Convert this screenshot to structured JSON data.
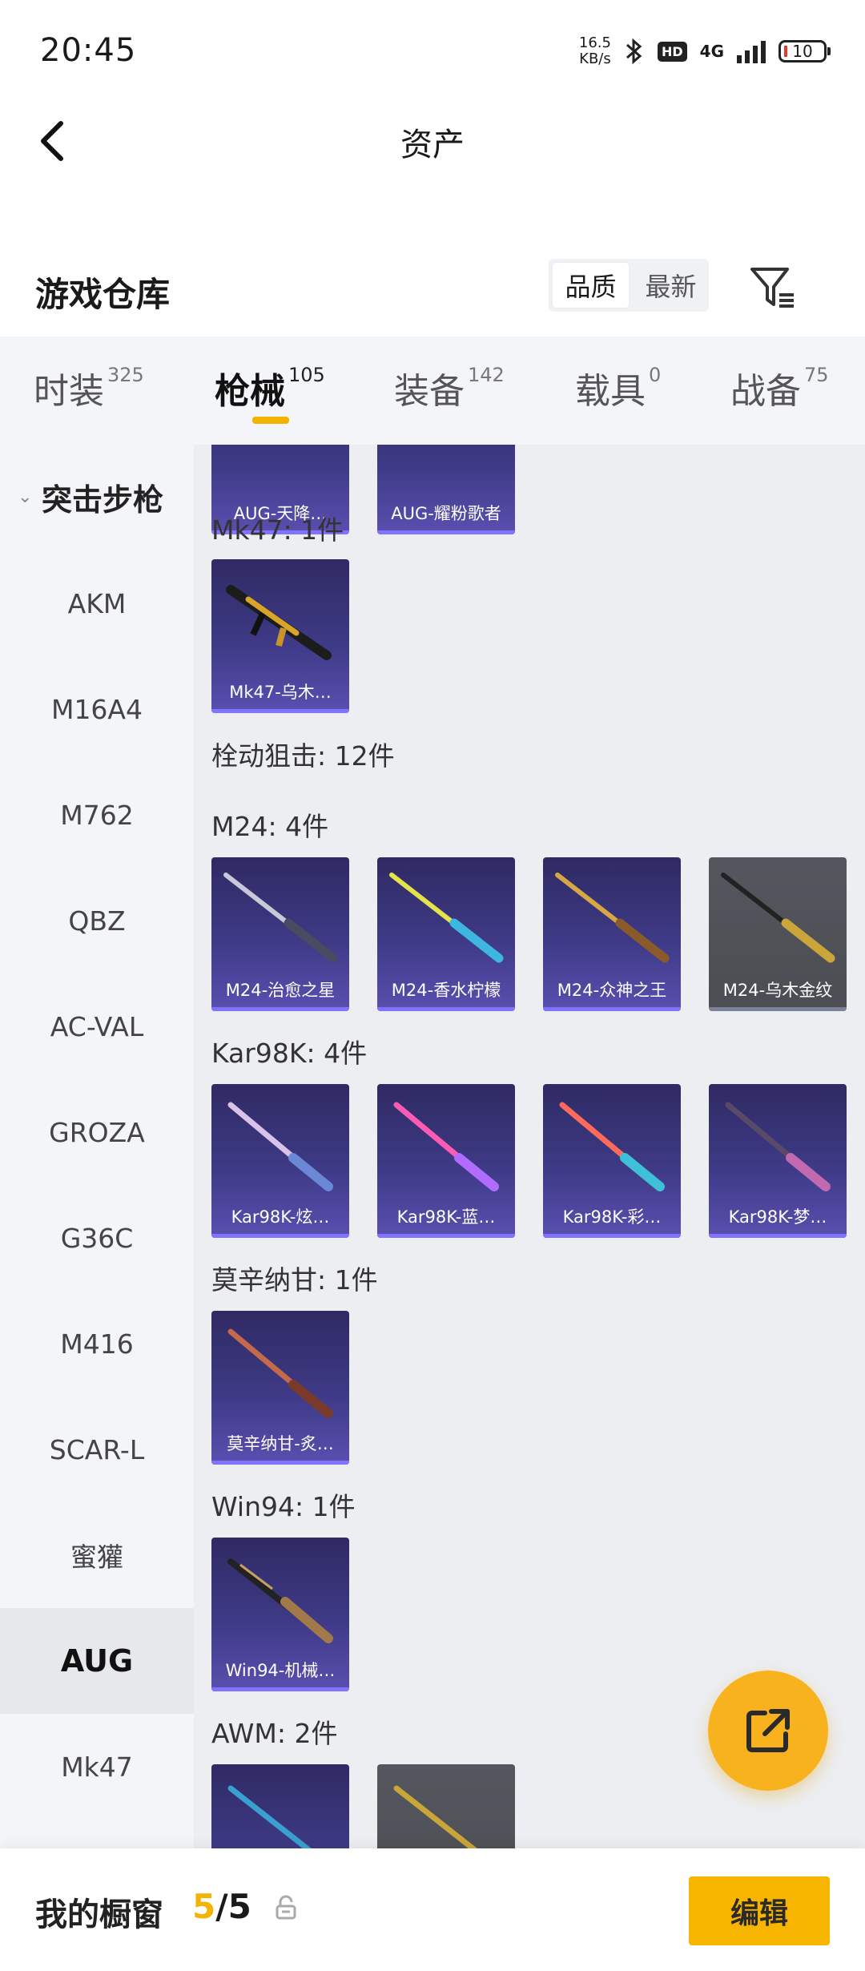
{
  "status_bar": {
    "time": "20:45",
    "net_speed": "16.5",
    "net_unit": "KB/s",
    "hd": "HD",
    "network": "4G",
    "battery": "10"
  },
  "header": {
    "title": "资产"
  },
  "section": {
    "title": "游戏仓库",
    "sort_quality": "品质",
    "sort_newest": "最新"
  },
  "tabs": [
    {
      "label": "时装",
      "count": "325"
    },
    {
      "label": "枪械",
      "count": "105"
    },
    {
      "label": "装备",
      "count": "142"
    },
    {
      "label": "载具",
      "count": "0"
    },
    {
      "label": "战备",
      "count": "75"
    }
  ],
  "sidebar": {
    "category": "突击步枪",
    "items": [
      "AKM",
      "M16A4",
      "M762",
      "QBZ",
      "AC-VAL",
      "GROZA",
      "G36C",
      "M416",
      "SCAR-L",
      "蜜獾",
      "AUG",
      "Mk47"
    ],
    "active": "AUG"
  },
  "content": {
    "aug_items": [
      "AUG-天降…",
      "AUG-耀粉歌者"
    ],
    "groups": [
      {
        "label": "Mk47: 1件",
        "items": [
          "Mk47-乌木…"
        ]
      },
      {
        "label": "栓动狙击: 12件"
      },
      {
        "label": "M24: 4件",
        "items": [
          "M24-治愈之星",
          "M24-香水柠檬",
          "M24-众神之王",
          "M24-乌木金纹"
        ]
      },
      {
        "label": "Kar98K: 4件",
        "items": [
          "Kar98K-炫…",
          "Kar98K-蓝…",
          "Kar98K-彩…",
          "Kar98K-梦…"
        ]
      },
      {
        "label": "莫辛纳甘: 1件",
        "items": [
          "莫辛纳甘-炙…"
        ]
      },
      {
        "label": "Win94: 1件",
        "items": [
          "Win94-机械…"
        ]
      },
      {
        "label": "AWM: 2件"
      }
    ]
  },
  "bottom_bar": {
    "label": "我的橱窗",
    "current": "5",
    "separator": "/",
    "total": "5",
    "edit": "编辑"
  },
  "colors": {
    "accent": "#f5b301",
    "card_purple": "#3e3a86",
    "card_gray": "#4f5157"
  }
}
